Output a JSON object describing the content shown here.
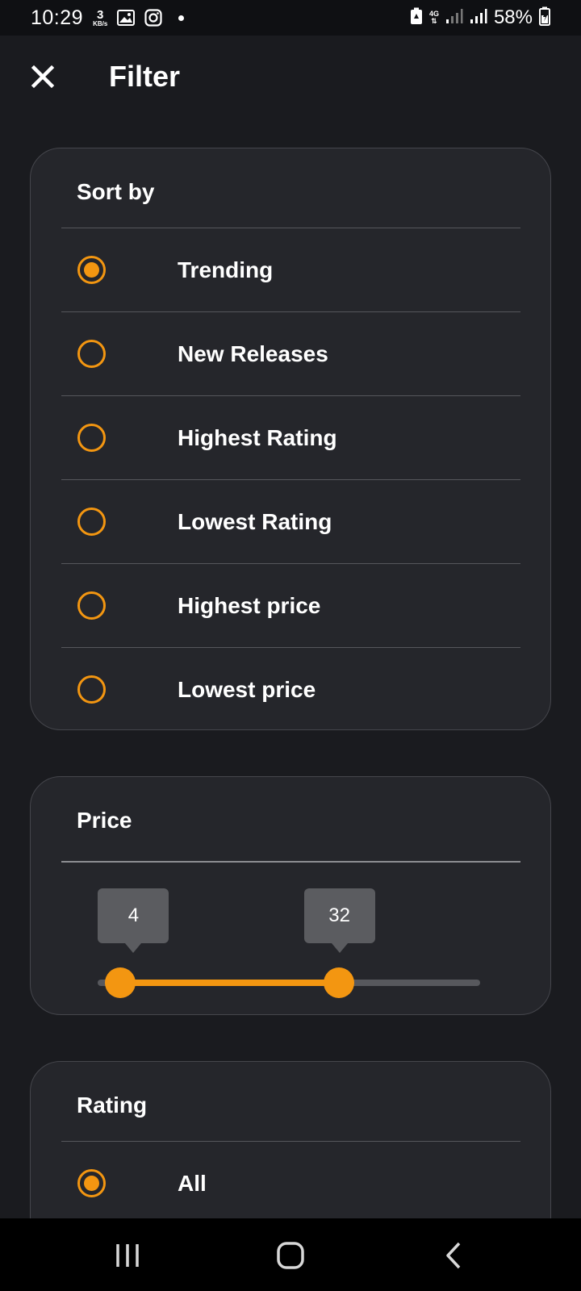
{
  "status_bar": {
    "time": "10:29",
    "net_speed_value": "3",
    "net_speed_unit": "KB/s",
    "network_type": "4G",
    "battery": "58%"
  },
  "header": {
    "title": "Filter",
    "close_icon": "close-icon"
  },
  "sort_by": {
    "title": "Sort by",
    "selected": "Trending",
    "options": [
      "Trending",
      "New Releases",
      "Highest Rating",
      "Lowest Rating",
      "Highest price",
      "Lowest price"
    ]
  },
  "price": {
    "title": "Price",
    "min_value": "4",
    "max_value": "32",
    "low_fraction": 0.06,
    "high_fraction": 0.63
  },
  "rating": {
    "title": "Rating",
    "selected": "All",
    "options": [
      "All"
    ]
  },
  "colors": {
    "accent": "#f39611",
    "background": "#1a1b1f",
    "card": "#25262b"
  },
  "nav_bar": {
    "icons": [
      "recents-icon",
      "home-icon",
      "back-icon"
    ]
  }
}
